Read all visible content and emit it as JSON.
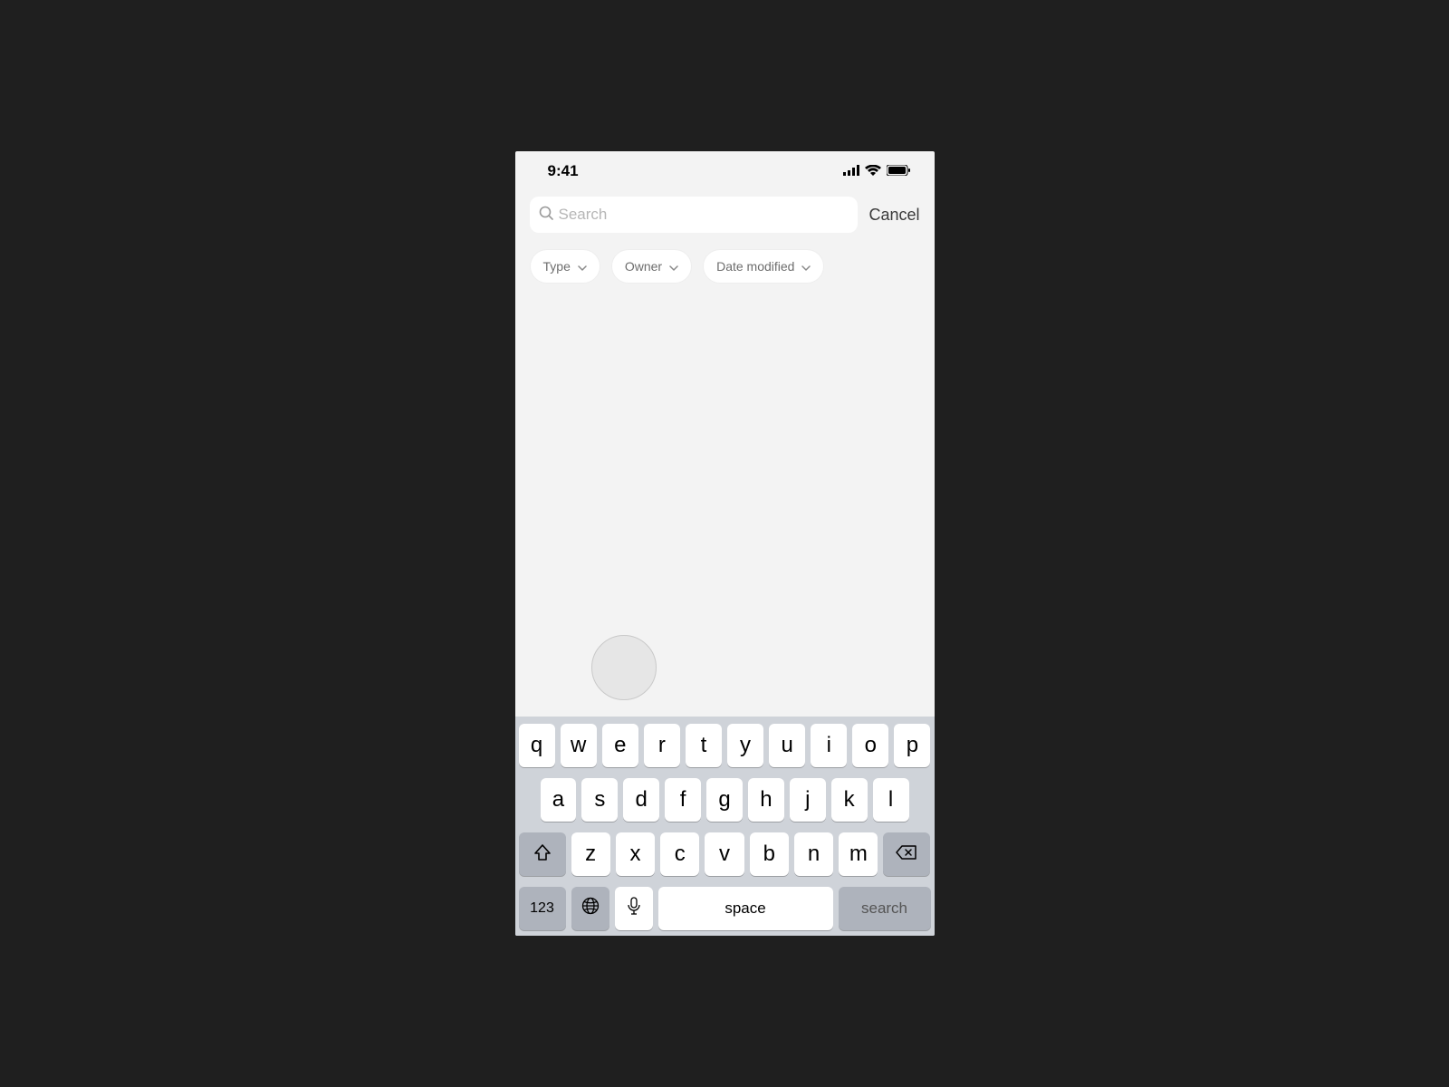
{
  "status": {
    "time": "9:41"
  },
  "search": {
    "placeholder": "Search",
    "value": "",
    "cancel": "Cancel"
  },
  "filters": [
    {
      "label": "Type"
    },
    {
      "label": "Owner"
    },
    {
      "label": "Date modified"
    }
  ],
  "keyboard": {
    "row1": [
      "q",
      "w",
      "e",
      "r",
      "t",
      "y",
      "u",
      "i",
      "o",
      "p"
    ],
    "row2": [
      "a",
      "s",
      "d",
      "f",
      "g",
      "h",
      "j",
      "k",
      "l"
    ],
    "row3": [
      "z",
      "x",
      "c",
      "v",
      "b",
      "n",
      "m"
    ],
    "numbers": "123",
    "space": "space",
    "action": "search"
  }
}
